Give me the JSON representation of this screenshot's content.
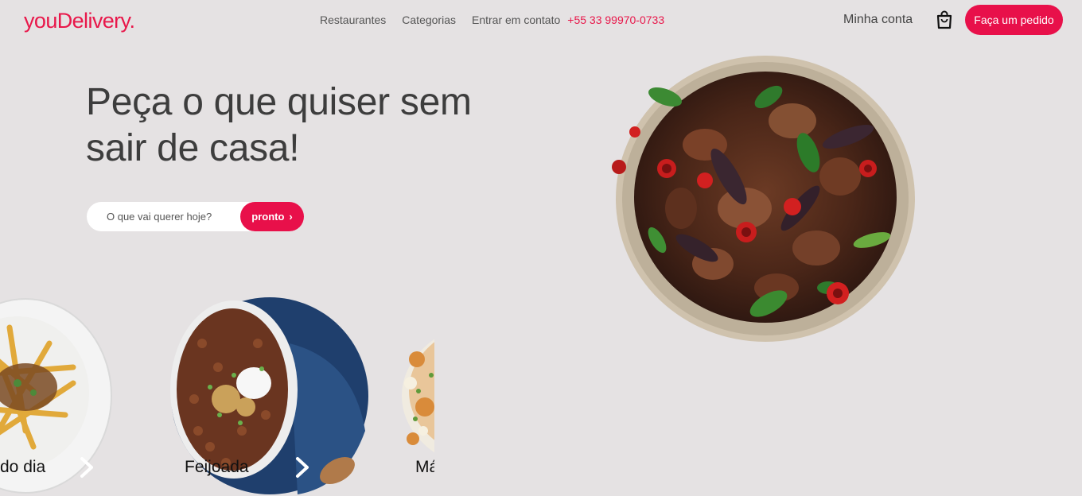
{
  "header": {
    "logo": "youDelivery.",
    "nav": {
      "restaurants": "Restaurantes",
      "categories": "Categorias",
      "contact": "Entrar em contato",
      "phone": "+55 33 99970-0733"
    },
    "account": "Minha conta",
    "order_button": "Faça um pedido"
  },
  "hero": {
    "title": "Peça o que quiser sem sair de casa!",
    "search": {
      "placeholder": "O que vai querer hoje?",
      "button": "pronto"
    }
  },
  "carousel": {
    "items": [
      {
        "label": "do dia"
      },
      {
        "label": "Feijoada"
      },
      {
        "label": "Má"
      }
    ]
  },
  "colors": {
    "accent": "#e8104a",
    "background": "#e5e2e3",
    "text": "#3d3d3d"
  }
}
